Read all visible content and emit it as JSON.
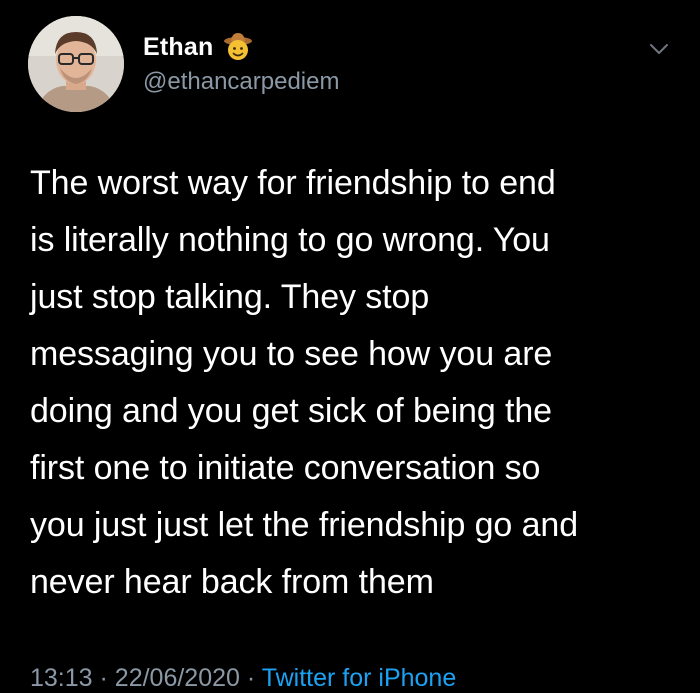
{
  "tweet": {
    "display_name": "Ethan",
    "handle": "@ethancarpediem",
    "badge_icon": "cowboy-face-emoji-icon",
    "menu_icon": "chevron-down-icon",
    "text": "The worst way for friendship to end\nis literally nothing to go wrong. You\njust stop talking. They stop\nmessaging you to see how you are\ndoing and you get sick of being the\nfirst one to initiate conversation so\nyou just just let the friendship go and\nnever hear back from them",
    "time": "13:13",
    "separator": "·",
    "date": "22/06/2020",
    "source": "Twitter for iPhone"
  },
  "colors": {
    "background": "#000000",
    "text": "#ffffff",
    "muted": "#8b98a5",
    "link": "#1da1f2"
  }
}
